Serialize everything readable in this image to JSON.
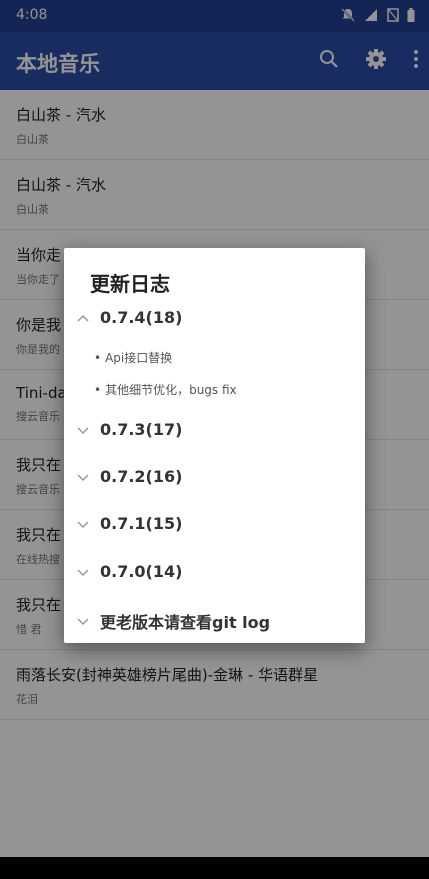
{
  "status": {
    "time": "4:08"
  },
  "app": {
    "title": "本地音乐"
  },
  "songs": [
    {
      "title": "白山茶 - 汽水",
      "subtitle": "白山茶"
    },
    {
      "title": "白山茶 - 汽水",
      "subtitle": "白山茶"
    },
    {
      "title": "当你走",
      "subtitle": "当你走了"
    },
    {
      "title": "你是我",
      "subtitle": "你是我的"
    },
    {
      "title": "Tini-dal",
      "subtitle": "搜云音乐"
    },
    {
      "title": "我只在",
      "subtitle": "搜云音乐"
    },
    {
      "title": "我只在",
      "subtitle": "在线热搜"
    },
    {
      "title": "我只在",
      "subtitle": "惜 君"
    },
    {
      "title": "雨落长安(封神英雄榜片尾曲)-金琳 - 华语群星",
      "subtitle": "花泪"
    }
  ],
  "dialog": {
    "title": "更新日志",
    "versions": [
      {
        "label": "0.7.4(18)",
        "expanded": true,
        "notes": [
          "Api接口替换",
          "其他细节优化，bugs fix"
        ]
      },
      {
        "label": "0.7.3(17)",
        "expanded": false
      },
      {
        "label": "0.7.2(16)",
        "expanded": false
      },
      {
        "label": "0.7.1(15)",
        "expanded": false
      },
      {
        "label": "0.7.0(14)",
        "expanded": false
      },
      {
        "label": "更老版本请查看git log",
        "expanded": false
      }
    ]
  }
}
